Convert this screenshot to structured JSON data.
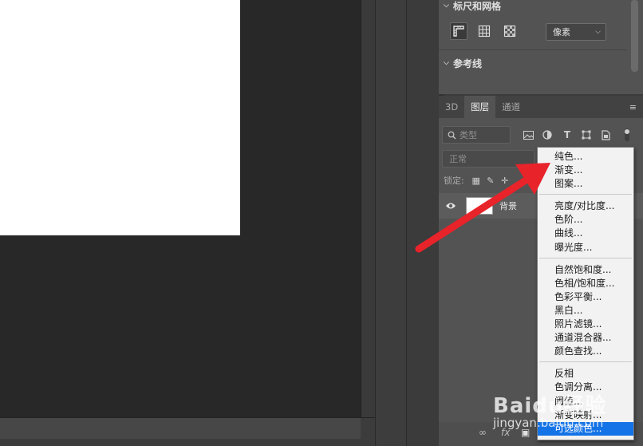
{
  "properties": {
    "rulers_grid_title": "标尺和网格",
    "units_value": "像素",
    "guides_title": "参考线"
  },
  "layers": {
    "tabs": [
      {
        "label": "3D"
      },
      {
        "label": "图层"
      },
      {
        "label": "通道"
      }
    ],
    "kind_placeholder": "类型",
    "blend_mode": "正常",
    "lock_label": "锁定:",
    "layer_name": "背景"
  },
  "adjust_menu": {
    "group1": [
      "纯色...",
      "渐变...",
      "图案..."
    ],
    "group2": [
      "亮度/对比度...",
      "色阶...",
      "曲线...",
      "曝光度..."
    ],
    "group3": [
      "自然饱和度...",
      "色相/饱和度...",
      "色彩平衡...",
      "黑白...",
      "照片滤镜...",
      "通道混合器...",
      "颜色查找..."
    ],
    "group4": [
      "反相",
      "色调分离...",
      "阈值...",
      "渐变映射...",
      "可选颜色..."
    ]
  },
  "watermark": {
    "logo": "Baidu经验",
    "url": "jingyan.baidu.com"
  },
  "colors": {
    "highlight": "#1473e6",
    "arrow": "#e8232a"
  }
}
